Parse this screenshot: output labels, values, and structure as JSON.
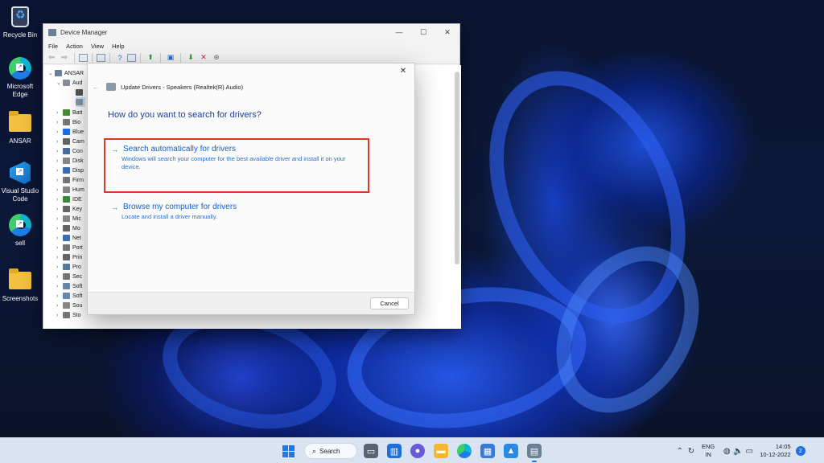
{
  "desktop": {
    "icons": [
      {
        "label": "Recycle Bin",
        "icon": "recycle-bin-icon"
      },
      {
        "label": "Microsoft Edge",
        "icon": "edge-icon"
      },
      {
        "label": "ANSAR",
        "icon": "folder-icon"
      },
      {
        "label": "Visual Studio Code",
        "icon": "vscode-icon"
      },
      {
        "label": "sell",
        "icon": "edge-icon"
      },
      {
        "label": "Screenshots",
        "icon": "folder-icon"
      }
    ]
  },
  "device_manager": {
    "title": "Device Manager",
    "menu": [
      "File",
      "Action",
      "View",
      "Help"
    ],
    "tree": {
      "root": "ANSAR",
      "expanded_category": "Aud",
      "categories": [
        "Batt",
        "Bio",
        "Blue",
        "Cam",
        "Con",
        "Disk",
        "Disp",
        "Firm",
        "Hum",
        "IDE",
        "Key",
        "Mic",
        "Mo",
        "Net",
        "Port",
        "Prin",
        "Pro",
        "Sec",
        "Soft",
        "Soft",
        "Sou",
        "Sto"
      ]
    }
  },
  "dialog": {
    "header": "Update Drivers - Speakers (Realtek(R) Audio)",
    "question": "How do you want to search for drivers?",
    "option_auto": {
      "title": "Search automatically for drivers",
      "description": "Windows will search your computer for the best available driver and install it on your device."
    },
    "option_browse": {
      "title": "Browse my computer for drivers",
      "description": "Locate and install a driver manually."
    },
    "cancel_label": "Cancel",
    "highlight_color": "#e63323"
  },
  "taskbar": {
    "search_label": "Search",
    "language": {
      "line1": "ENG",
      "line2": "IN"
    },
    "time": "14:05",
    "date": "10-12-2022",
    "notification_count": "2"
  }
}
